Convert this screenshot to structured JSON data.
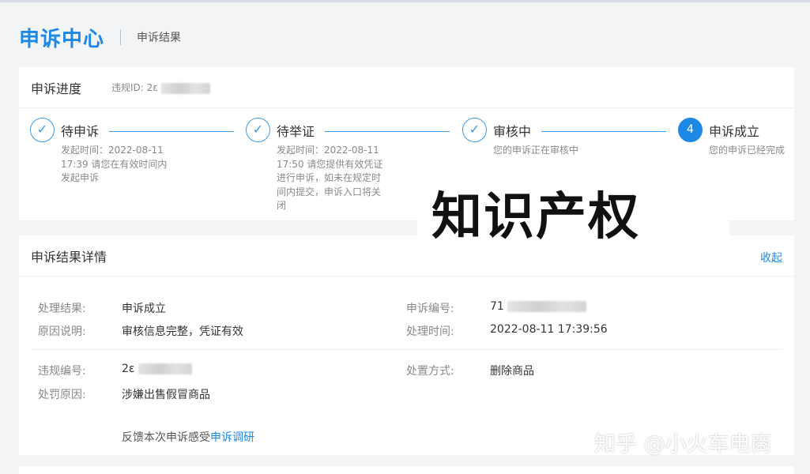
{
  "header": {
    "brand": "申诉中心",
    "breadcrumb": "申诉结果"
  },
  "progress": {
    "title": "申诉进度",
    "violation_id_label": "违规ID: 2ε",
    "steps": [
      {
        "name": "待申诉",
        "desc": "发起时间：2022-08-11 17:39 请您在有效时间内发起申诉",
        "state": "done"
      },
      {
        "name": "待举证",
        "desc": "发起时间：2022-08-11 17:50 请您提供有效凭证进行申诉，如未在规定时间内提交，申诉入口将关闭",
        "state": "done"
      },
      {
        "name": "审核中",
        "desc": "您的申诉正在审核中",
        "state": "done"
      },
      {
        "name": "申诉成立",
        "number": "4",
        "desc": "您的申诉已经完成",
        "state": "active"
      }
    ]
  },
  "overlay_text": "知识产权",
  "result": {
    "title": "申诉结果详情",
    "collapse_label": "收起",
    "fields": {
      "result_label": "处理结果:",
      "result_value": "申诉成立",
      "appeal_no_label": "申诉编号:",
      "appeal_no_value": "71",
      "reason_label": "原因说明:",
      "reason_value": "审核信息完整，凭证有效",
      "time_label": "处理时间:",
      "time_value": "2022-08-11 17:39:56",
      "violation_no_label": "违规编号:",
      "violation_no_value": "2ε",
      "method_label": "处置方式:",
      "method_value": "删除商品",
      "penalty_label": "处罚原因:",
      "penalty_value": "涉嫌出售假冒商品"
    },
    "feedback_text": "反馈本次申诉感受",
    "feedback_link": "申诉调研"
  },
  "watermark": "知乎 @小火车电商"
}
